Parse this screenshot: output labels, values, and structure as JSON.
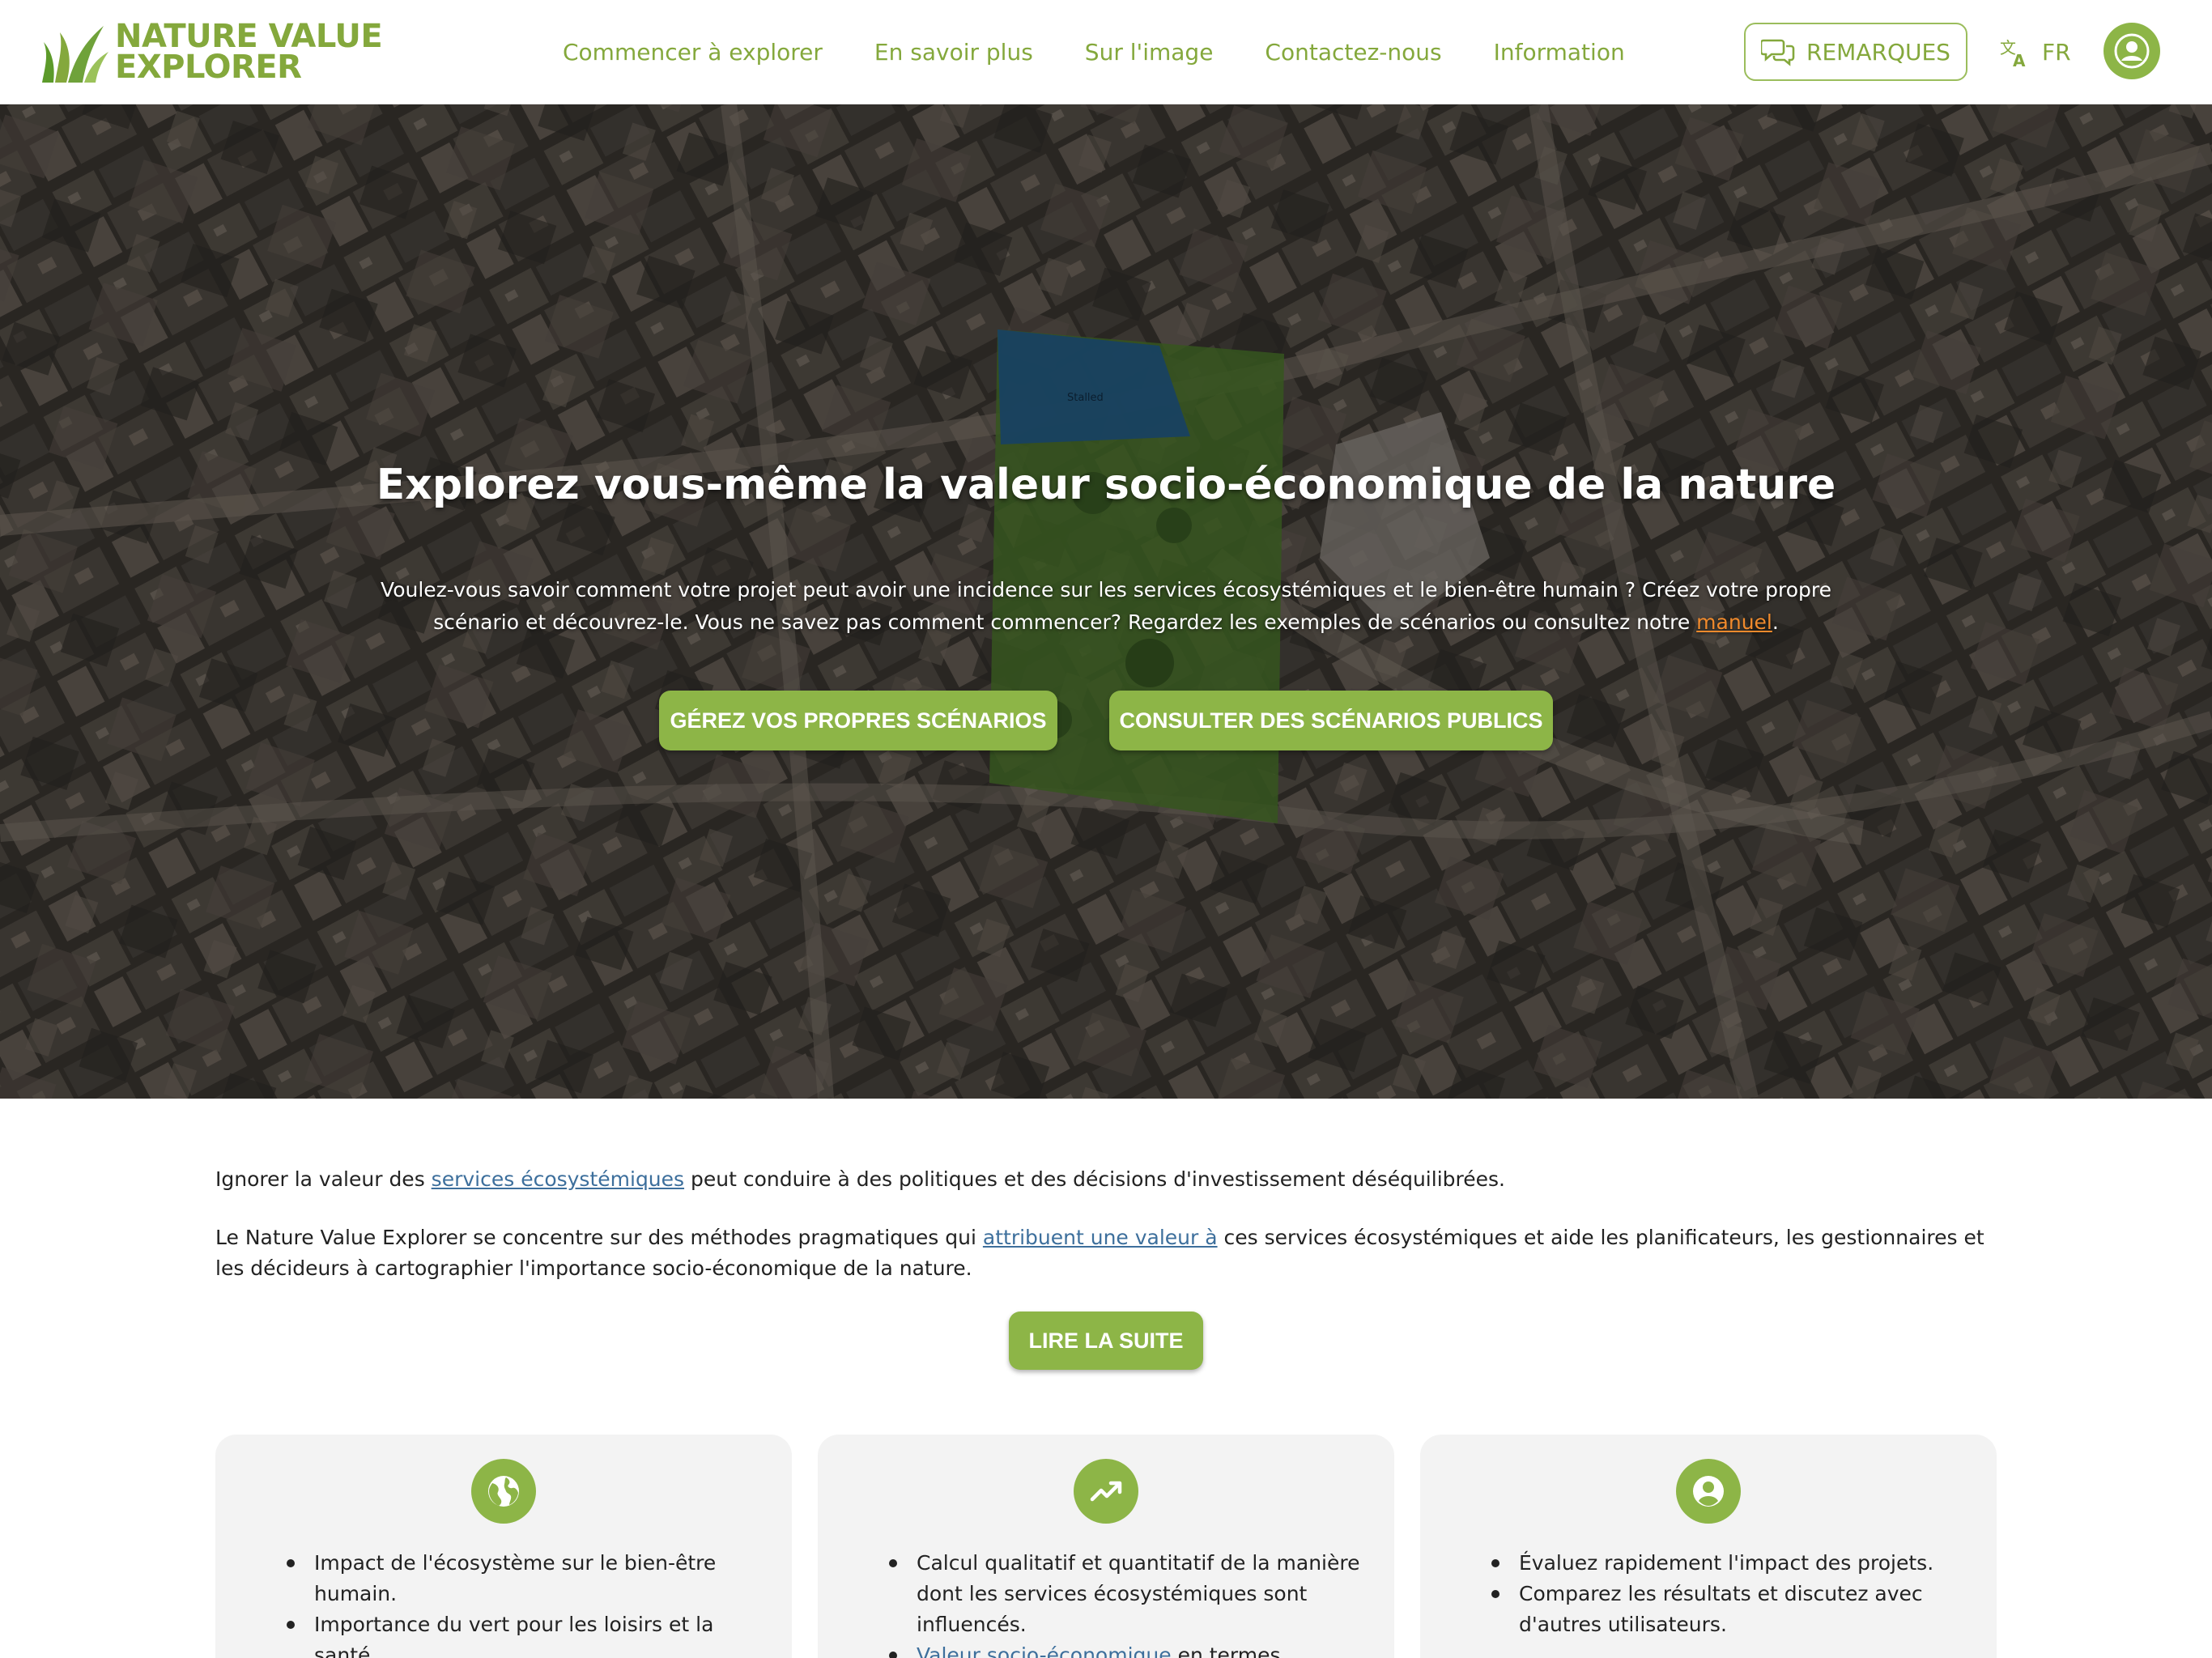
{
  "header": {
    "logo_line1": "NATURE VALUE",
    "logo_line2": "EXPLORER",
    "nav": [
      "Commencer à explorer",
      "En savoir plus",
      "Sur l'image",
      "Contactez-nous",
      "Information"
    ],
    "feedback_label": "REMARQUES",
    "language": "FR"
  },
  "hero": {
    "title": "Explorez vous-même la valeur socio-économique de la nature",
    "desc_part1": "Voulez-vous savoir comment votre projet peut avoir une incidence sur les services écosystémiques et le bien-être humain ? Créez votre propre scénario et découvrez-le. Vous ne savez pas comment commencer? Regardez les exemples de scénarios ou consultez notre ",
    "desc_link": "manuel",
    "desc_part2": ".",
    "btn_own": "GÉREZ VOS PROPRES SCÉNARIOS",
    "btn_public": "CONSULTER DES SCÉNARIOS PUBLICS",
    "map_label": "Stalled"
  },
  "intro": {
    "p1_before": "Ignorer la valeur des ",
    "p1_link": "services écosystémiques",
    "p1_after": " peut conduire à des politiques et des décisions d'investissement déséquilibrées.",
    "p2_before": "Le Nature Value Explorer se concentre sur des méthodes pragmatiques qui ",
    "p2_link": "attribuent une valeur à",
    "p2_after": " ces services écosystémiques et aide les planificateurs, les gestionnaires et les décideurs à cartographier l'importance socio-économique de la nature.",
    "read_more": "LIRE LA SUITE"
  },
  "cards": [
    {
      "icon": "globe-icon",
      "items": [
        "Impact de l'écosystème sur le bien-être humain.",
        "Importance du vert pour les loisirs et la santé."
      ]
    },
    {
      "icon": "trending-up-icon",
      "items": [
        "Calcul qualitatif et quantitatif de la manière dont les services écosystémiques sont influencés."
      ],
      "link_item_link": "Valeur socio-économique",
      "link_item_after": " en termes physiques et monétaires."
    },
    {
      "icon": "account-circle-icon",
      "items": [
        "Évaluez rapidement l'impact des projets.",
        "Comparez les résultats et discutez avec d'autres utilisateurs."
      ]
    }
  ],
  "colors": {
    "brand_green": "#8db547",
    "brand_text_green": "#84a83c",
    "link_blue": "#3d6f9c",
    "link_orange": "#f08a2c"
  }
}
